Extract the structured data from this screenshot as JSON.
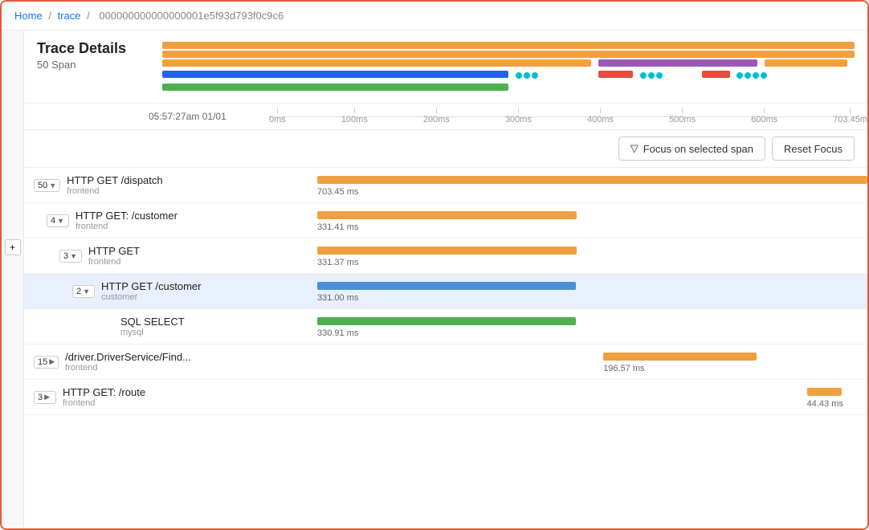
{
  "breadcrumb": {
    "home": "Home",
    "sep1": "/",
    "trace": "trace",
    "sep2": "/",
    "id": "000000000000000001e5f93d793f0c9c6"
  },
  "header": {
    "title": "Trace Details",
    "subtitle": "50 Span"
  },
  "timestamp": "05:57:27am 01/01",
  "ruler": {
    "ticks": [
      "0ms",
      "100ms",
      "200ms",
      "300ms",
      "400ms",
      "500ms",
      "600ms",
      "703.45m"
    ]
  },
  "toolbar": {
    "focus_label": "Focus on selected span",
    "reset_label": "Reset Focus"
  },
  "sidebar_toggle": "+",
  "spans": [
    {
      "id": "s1",
      "indent": 0,
      "badge": "50",
      "badge_arrow": "▼",
      "name": "HTTP GET /dispatch",
      "service": "frontend",
      "bar_color": "#f0a040",
      "bar_left": "0%",
      "bar_width": "100%",
      "duration": "703.45 ms",
      "highlighted": false
    },
    {
      "id": "s2",
      "indent": 1,
      "badge": "4",
      "badge_arrow": "▼",
      "name": "HTTP GET: /customer",
      "service": "frontend",
      "bar_color": "#f0a040",
      "bar_left": "0%",
      "bar_width": "47.1%",
      "duration": "331.41 ms",
      "highlighted": false
    },
    {
      "id": "s3",
      "indent": 2,
      "badge": "3",
      "badge_arrow": "▼",
      "name": "HTTP GET",
      "service": "frontend",
      "bar_color": "#f0a040",
      "bar_left": "0%",
      "bar_width": "47.1%",
      "duration": "331.37 ms",
      "highlighted": false
    },
    {
      "id": "s4",
      "indent": 3,
      "badge": "2",
      "badge_arrow": "▼",
      "name": "HTTP GET /customer",
      "service": "customer",
      "bar_color": "#4a90d9",
      "bar_left": "0%",
      "bar_width": "47.0%",
      "duration": "331.00 ms",
      "highlighted": true
    },
    {
      "id": "s5",
      "indent": 4,
      "badge": "",
      "badge_arrow": "",
      "name": "SQL SELECT",
      "service": "mysql",
      "bar_color": "#4caf50",
      "bar_left": "0%",
      "bar_width": "47.0%",
      "duration": "330.91 ms",
      "highlighted": false
    },
    {
      "id": "s6",
      "indent": 0,
      "badge": "15",
      "badge_arrow": "▶",
      "name": "/driver.DriverService/Find...",
      "service": "frontend",
      "bar_color": "#f0a040",
      "bar_left": "52%",
      "bar_width": "27.9%",
      "duration": "196.57 ms",
      "highlighted": false
    },
    {
      "id": "s7",
      "indent": 0,
      "badge": "3",
      "badge_arrow": "▶",
      "name": "HTTP GET: /route",
      "service": "frontend",
      "bar_color": "#f0a040",
      "bar_left": "89%",
      "bar_width": "6.3%",
      "duration": "44.43 ms",
      "highlighted": false
    }
  ],
  "colors": {
    "accent": "#e05c3a",
    "orange": "#f0a040",
    "blue": "#4a90d9",
    "green": "#4caf50",
    "purple": "#9b59b6",
    "red": "#e74c3c",
    "cyan": "#00bcd4"
  }
}
